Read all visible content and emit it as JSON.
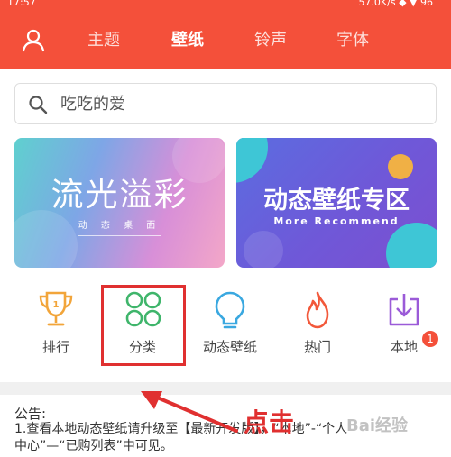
{
  "status_bar": {
    "time": "17:57",
    "right": "57.0K/s ◆ ▼ 96"
  },
  "nav": {
    "tabs": [
      "主题",
      "壁纸",
      "铃声",
      "字体"
    ],
    "active": "壁纸"
  },
  "search": {
    "text": "吃吃的爱"
  },
  "banners": [
    {
      "title": "流光溢彩",
      "subtitle": "动 态 桌 面"
    },
    {
      "title": "动态壁纸专区",
      "subtitle": "More Recommend"
    }
  ],
  "categories": [
    {
      "label": "排行",
      "icon": "trophy-icon",
      "color": "#f2a53a"
    },
    {
      "label": "分类",
      "icon": "grid-circles-icon",
      "color": "#3fb56b"
    },
    {
      "label": "动态壁纸",
      "icon": "bulb-icon",
      "color": "#3aa8e0"
    },
    {
      "label": "热门",
      "icon": "flame-icon",
      "color": "#f2583a"
    },
    {
      "label": "本地",
      "icon": "download-icon",
      "color": "#9b5bd8",
      "badge": "1"
    }
  ],
  "notice": {
    "title": "公告:",
    "line1": "1.查看本地动态壁纸请升级至【最新开发版】，“本地”-“个人",
    "line2": "中心”—“已购列表”中可见。"
  },
  "annotation": {
    "label": "点击"
  },
  "watermark": "Bai经验",
  "colors": {
    "brand": "#f4503a",
    "annotation": "#e03030"
  }
}
